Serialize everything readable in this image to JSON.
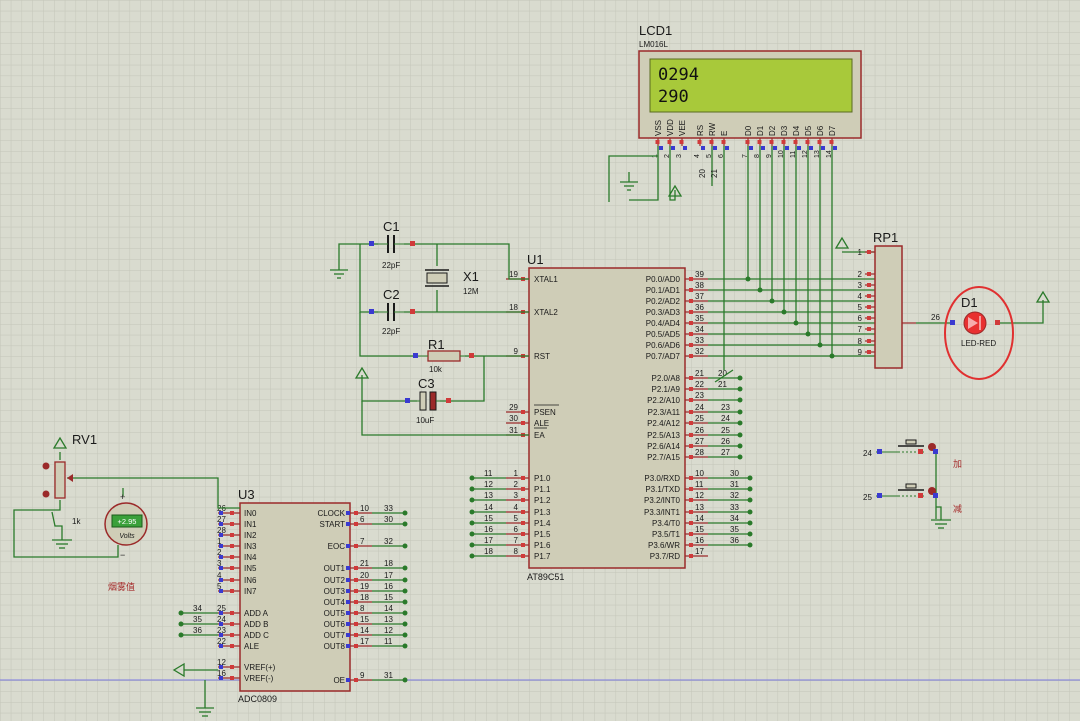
{
  "colors": {
    "background": "#d9dbcf",
    "grid": "#c3c5b8",
    "wire": "#2a7a2a",
    "chip_fill": "#cfcdb7",
    "chip_border": "#9b2a2a",
    "label": "#1a1a1a",
    "lcd_screen": "#a8c93a",
    "pin_red": "#d03a3a",
    "pin_blue": "#3a3ad0",
    "led": "#e83030",
    "highlight": "#e03030",
    "cn_text": "#a52a2a"
  },
  "lcd": {
    "ref": "LCD1",
    "model": "LM016L",
    "line1": "0294",
    "line2": "290",
    "pin_names": [
      "VSS",
      "VDD",
      "VEE",
      "RS",
      "RW",
      "E",
      "D0",
      "D1",
      "D2",
      "D3",
      "D4",
      "D5",
      "D6",
      "D7"
    ],
    "pin_numbers": [
      "1",
      "2",
      "3",
      "4",
      "5",
      "6",
      "7",
      "8",
      "9",
      "10",
      "11",
      "12",
      "13",
      "14"
    ]
  },
  "u1": {
    "ref": "U1",
    "model": "AT89C51",
    "left_pins": [
      [
        "19",
        "XTAL1"
      ],
      [
        "18",
        "XTAL2"
      ],
      [
        "9",
        "RST"
      ],
      [
        "29",
        "PSEN"
      ],
      [
        "30",
        "ALE"
      ],
      [
        "31",
        "EA"
      ],
      [
        "1",
        "P1.0"
      ],
      [
        "2",
        "P1.1"
      ],
      [
        "3",
        "P1.2"
      ],
      [
        "4",
        "P1.3"
      ],
      [
        "5",
        "P1.4"
      ],
      [
        "6",
        "P1.5"
      ],
      [
        "7",
        "P1.6"
      ],
      [
        "8",
        "P1.7"
      ]
    ],
    "right_pins": [
      [
        "39",
        "P0.0/AD0"
      ],
      [
        "38",
        "P0.1/AD1"
      ],
      [
        "37",
        "P0.2/AD2"
      ],
      [
        "36",
        "P0.3/AD3"
      ],
      [
        "35",
        "P0.4/AD4"
      ],
      [
        "34",
        "P0.5/AD5"
      ],
      [
        "33",
        "P0.6/AD6"
      ],
      [
        "32",
        "P0.7/AD7"
      ],
      [
        "21",
        "P2.0/A8"
      ],
      [
        "22",
        "P2.1/A9"
      ],
      [
        "23",
        "P2.2/A10"
      ],
      [
        "24",
        "P2.3/A11"
      ],
      [
        "25",
        "P2.4/A12"
      ],
      [
        "26",
        "P2.5/A13"
      ],
      [
        "27",
        "P2.6/A14"
      ],
      [
        "28",
        "P2.7/A15"
      ],
      [
        "10",
        "P3.0/RXD"
      ],
      [
        "11",
        "P3.1/TXD"
      ],
      [
        "12",
        "P3.2/INT0"
      ],
      [
        "13",
        "P3.3/INT1"
      ],
      [
        "14",
        "P3.4/T0"
      ],
      [
        "15",
        "P3.5/T1"
      ],
      [
        "16",
        "P3.6/WR"
      ],
      [
        "17",
        "P3.7/RD"
      ]
    ],
    "p1_net_labels": [
      "11",
      "12",
      "13",
      "14",
      "15",
      "16",
      "17",
      "18"
    ],
    "p2_net_labels": [
      "20",
      "21",
      "",
      "23",
      "24",
      "25",
      "26",
      "27"
    ],
    "p3_net_labels": [
      "30",
      "31",
      "32",
      "33",
      "34",
      "35",
      "36",
      ""
    ]
  },
  "u3": {
    "ref": "U3",
    "model": "ADC0809",
    "left_pins": [
      [
        "26",
        "IN0"
      ],
      [
        "27",
        "IN1"
      ],
      [
        "28",
        "IN2"
      ],
      [
        "1",
        "IN3"
      ],
      [
        "2",
        "IN4"
      ],
      [
        "3",
        "IN5"
      ],
      [
        "4",
        "IN6"
      ],
      [
        "5",
        "IN7"
      ],
      [
        "25",
        "ADD A"
      ],
      [
        "24",
        "ADD B"
      ],
      [
        "23",
        "ADD C"
      ],
      [
        "22",
        "ALE"
      ],
      [
        "12",
        "VREF(+)"
      ],
      [
        "16",
        "VREF(-)"
      ]
    ],
    "left_net_labels": [
      "",
      "",
      "",
      "",
      "",
      "",
      "",
      "",
      "34",
      "35",
      "36",
      "",
      "",
      ""
    ],
    "right_pins": [
      [
        "10",
        "CLOCK"
      ],
      [
        "6",
        "START"
      ],
      [
        "7",
        "EOC"
      ],
      [
        "21",
        "OUT1"
      ],
      [
        "20",
        "OUT2"
      ],
      [
        "19",
        "OUT3"
      ],
      [
        "18",
        "OUT4"
      ],
      [
        "8",
        "OUT5"
      ],
      [
        "15",
        "OUT6"
      ],
      [
        "14",
        "OUT7"
      ],
      [
        "17",
        "OUT8"
      ],
      [
        "9",
        "OE"
      ]
    ],
    "right_net_labels": [
      "33",
      "30",
      "32",
      "18",
      "17",
      "16",
      "15",
      "14",
      "13",
      "12",
      "11",
      "31"
    ]
  },
  "c1": {
    "ref": "C1",
    "value": "22pF"
  },
  "c2": {
    "ref": "C2",
    "value": "22pF"
  },
  "x1": {
    "ref": "X1",
    "value": "12M"
  },
  "r1": {
    "ref": "R1",
    "value": "10k"
  },
  "c3": {
    "ref": "C3",
    "value": "10uF"
  },
  "rp1": {
    "ref": "RP1",
    "pins": [
      "1",
      "2",
      "3",
      "4",
      "5",
      "6",
      "7",
      "8",
      "9"
    ]
  },
  "d1": {
    "ref": "D1",
    "model": "LED-RED",
    "net": "26"
  },
  "rv1": {
    "ref": "RV1",
    "value": "1k"
  },
  "voltmeter": {
    "reading": "+2.95",
    "unit": "Volts",
    "plus": "+",
    "minus": "−",
    "caption": "烟雾值"
  },
  "buttons": [
    {
      "net": "24",
      "label": "加"
    },
    {
      "net": "25",
      "label": "减"
    }
  ],
  "lcd_net_labels": [
    "20",
    "21"
  ]
}
